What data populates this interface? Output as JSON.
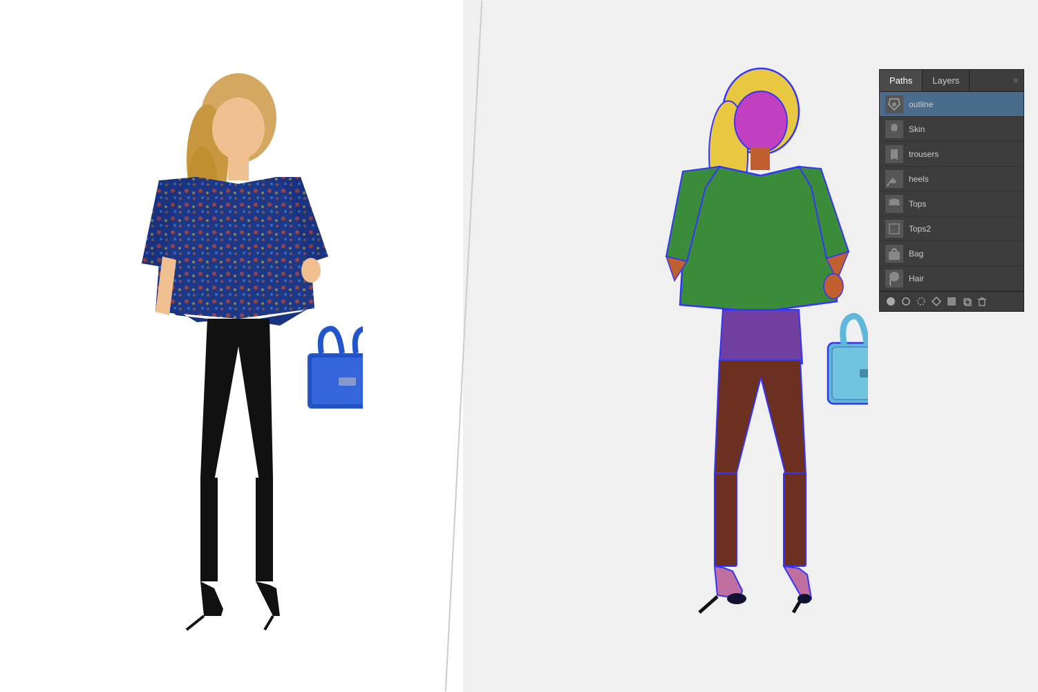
{
  "panel": {
    "title": "Paths",
    "tabs": [
      {
        "label": "Paths",
        "active": true
      },
      {
        "label": "Layers",
        "active": false
      }
    ],
    "layers": [
      {
        "name": "outline",
        "selected": true,
        "thumb_color": "#555"
      },
      {
        "name": "Skin",
        "selected": false,
        "thumb_color": "#888"
      },
      {
        "name": "trousers",
        "selected": false,
        "thumb_color": "#555"
      },
      {
        "name": "heels",
        "selected": false,
        "thumb_color": "#666"
      },
      {
        "name": "Tops",
        "selected": false,
        "thumb_color": "#444"
      },
      {
        "name": "Tops2",
        "selected": false,
        "thumb_color": "#444"
      },
      {
        "name": "Bag",
        "selected": false,
        "thumb_color": "#555"
      },
      {
        "name": "Hair",
        "selected": false,
        "thumb_color": "#555"
      }
    ],
    "footer_icons": [
      "circle-filled",
      "circle-outline",
      "dashed-circle",
      "diamond",
      "square",
      "duplicate",
      "trash"
    ]
  },
  "colors": {
    "hair": "#e8c840",
    "skin_face": "#c06030",
    "skin_neck": "#c06030",
    "top": "#3a8c3a",
    "shorts": "#7040a0",
    "trousers": "#6b3020",
    "bag": "#60b8d8",
    "heels": "#c070a0",
    "heels2": "#c070a0",
    "outline_stroke": "#4040ff",
    "panel_bg": "#3c3c3c",
    "panel_selected": "#4a6c8c"
  }
}
